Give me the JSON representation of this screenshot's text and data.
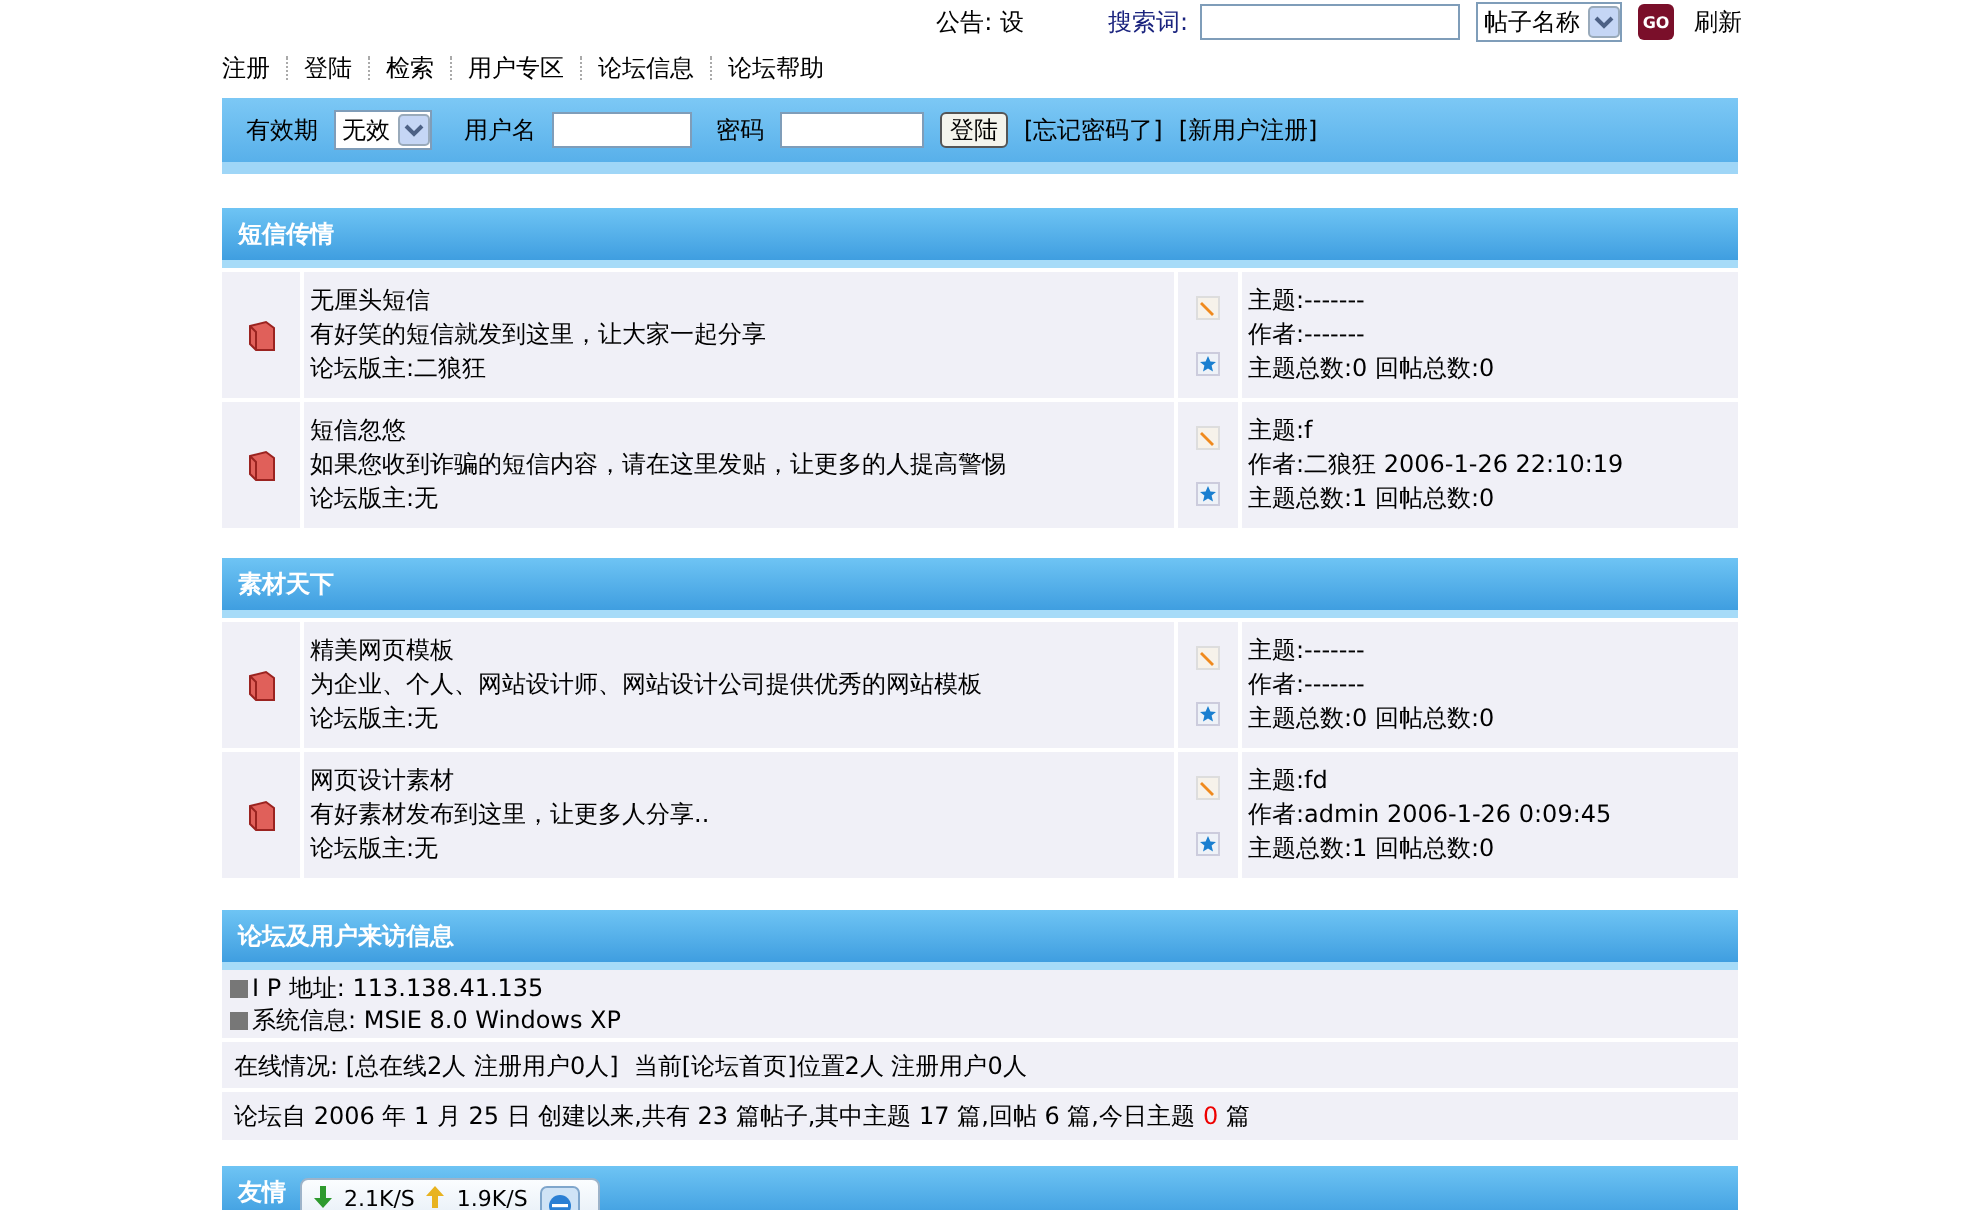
{
  "announcement": "公告: 设",
  "search": {
    "label": "搜索词:",
    "scope": "帖子名称",
    "go": "GO",
    "refresh": "刷新"
  },
  "nav": [
    "注册",
    "登陆",
    "检索",
    "用户专区",
    "论坛信息",
    "论坛帮助"
  ],
  "login": {
    "expiry_label": "有效期",
    "expiry": "无效",
    "username_label": "用户名",
    "password_label": "密码",
    "submit": "登陆",
    "links": [
      "[忘记密码了]",
      "[新用户注册]"
    ]
  },
  "sections": [
    {
      "title": "短信传情",
      "forums": [
        {
          "name": "无厘头短信",
          "description": "有好笑的短信就发到这里，让大家一起分享",
          "moderator": "论坛版主:二狼狂",
          "topic": "主题:-------",
          "author": "作者:-------",
          "counts": "主题总数:0 回帖总数:0"
        },
        {
          "name": "短信忽悠",
          "description": "如果您收到诈骗的短信内容，请在这里发贴，让更多的人提高警惕",
          "moderator": "论坛版主:无",
          "topic": "主题:f",
          "author": "作者:二狼狂 2006-1-26 22:10:19",
          "counts": "主题总数:1 回帖总数:0"
        }
      ]
    },
    {
      "title": "素材天下",
      "forums": [
        {
          "name": "精美网页模板",
          "description": "为企业、个人、网站设计师、网站设计公司提供优秀的网站模板",
          "moderator": "论坛版主:无",
          "topic": "主题:-------",
          "author": "作者:-------",
          "counts": "主题总数:0 回帖总数:0"
        },
        {
          "name": "网页设计素材",
          "description": "有好素材发布到这里，让更多人分享..",
          "moderator": "论坛版主:无",
          "topic": "主题:fd",
          "author": "作者:admin 2006-1-26 0:09:45",
          "counts": "主题总数:1 回帖总数:0"
        }
      ]
    }
  ],
  "visitor_info": {
    "title": "论坛及用户来访信息",
    "ip": "I P 地址: 113.138.41.135",
    "system": "系统信息: MSIE 8.0 Windows XP",
    "online": "在线情况: [总在线2人 注册用户0人]  当前[论坛首页]位置2人 注册用户0人",
    "stats": "论坛自 2006 年 1 月 25 日 创建以来,共有 23 篇帖子,其中主题 17 篇,回帖 6 篇,今日主题",
    "today_topics": "0",
    "stats_end": "篇"
  },
  "links_section": {
    "title": "友情"
  },
  "speed_widget": {
    "download": "2.1K/S",
    "upload": "1.9K/S"
  }
}
